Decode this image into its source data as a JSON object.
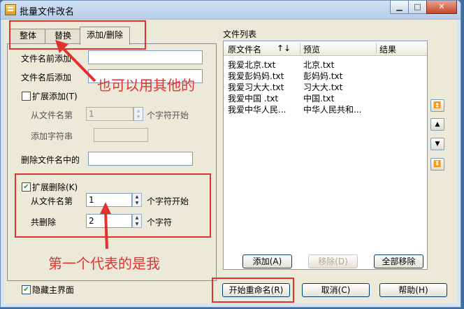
{
  "window": {
    "title": "批量文件改名"
  },
  "tabs": [
    "整体",
    "替换",
    "添加/删除"
  ],
  "panel": {
    "prefix_label": "文件名前添加",
    "suffix_label": "文件名后添加",
    "ext_add_label": "扩展添加(T)",
    "from_char_label": "从文件名第",
    "from_char_value": "1",
    "start_label": "个字符开始",
    "add_string_label": "添加字符串",
    "delete_in_name_label": "删除文件名中的",
    "ext_delete_label": "扩展删除(K)",
    "del_from_label": "从文件名第",
    "del_from_value": "1",
    "del_start_label": "个字符开始",
    "del_count_label": "共删除",
    "del_count_value": "2",
    "del_char_label": "个字符"
  },
  "file_list": {
    "label": "文件列表",
    "columns": [
      "原文件名",
      "预览",
      "结果"
    ],
    "sort_glyph": "↑↓",
    "rows": [
      {
        "original": "我爱北京.txt",
        "preview": "北京.txt",
        "result": ""
      },
      {
        "original": "我爱彭妈妈.txt",
        "preview": "彭妈妈.txt",
        "result": ""
      },
      {
        "original": "我爱习大大.txt",
        "preview": "习大大.txt",
        "result": ""
      },
      {
        "original": "我爱中国 .txt",
        "preview": "中国.txt",
        "result": ""
      },
      {
        "original": "我爱中华人民...",
        "preview": "中华人民共和...",
        "result": ""
      }
    ],
    "add_button": "添加(A)",
    "remove_button": "移除(D)",
    "remove_all_button": "全部移除"
  },
  "nav_buttons": [
    "top",
    "up",
    "down",
    "bottom"
  ],
  "bottom": {
    "hide_main_label": "隐藏主界面",
    "start_rename": "开始重命名(R)",
    "cancel": "取消(C)",
    "help": "帮助(H)"
  },
  "annotations": {
    "note1": "也可以用其他的",
    "note2": "第一个代表的是我"
  },
  "colors": {
    "annotation": "#e0322f",
    "accent": "#003c74"
  }
}
